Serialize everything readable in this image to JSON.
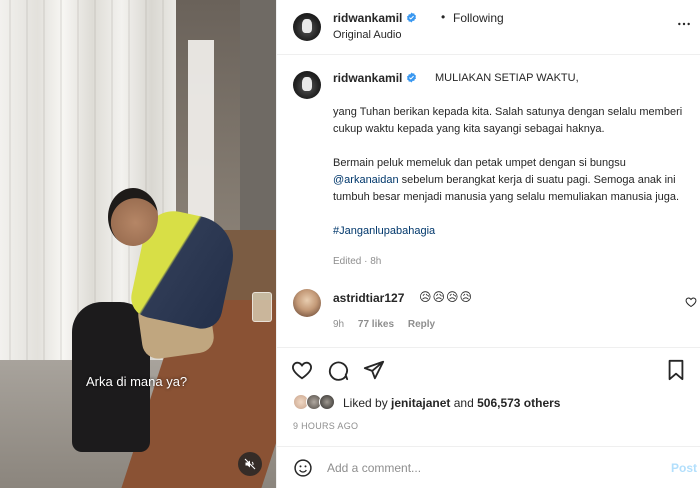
{
  "media": {
    "caption_overlay": "Arka di mana ya?",
    "mute_icon": "speaker-muted-icon"
  },
  "header": {
    "username": "ridwankamil",
    "separator": "•",
    "follow_status": "Following",
    "audio_label": "Original Audio",
    "more_icon": "more-horizontal-icon"
  },
  "caption": {
    "username": "ridwankamil",
    "title": "MULIAKAN SETIAP WAKTU,",
    "paragraph1": "yang Tuhan berikan kepada kita. Salah satunya dengan selalu memberi cukup waktu kepada yang kita sayangi sebagai hak­nya.",
    "paragraph2_before": "Bermain peluk memeluk dan petak umpet dengan si bungsu ",
    "paragraph2_mention": "@arkanaidan",
    "paragraph2_after": " sebelum berangkat kerja di suatu pagi. Semoga anak ini tumbuh besar menjadi manusia yang selalu memuliakan manusia juga.",
    "hashtag": "#Janganlupabahagia",
    "edited": "Edited · 8h"
  },
  "comment": {
    "username": "astridtiar127",
    "text": "😥😥😥😥",
    "age": "9h",
    "likes": "77 likes",
    "reply": "Reply"
  },
  "actions": {
    "like_icon": "heart-icon",
    "comment_icon": "comment-bubble-icon",
    "share_icon": "paper-plane-icon",
    "save_icon": "bookmark-icon"
  },
  "likes": {
    "prefix": "Liked by ",
    "user": "jenitajanet",
    "middle": " and ",
    "count": "506,573 others"
  },
  "timestamp": "9 HOURS AGO",
  "add_comment": {
    "placeholder": "Add a comment...",
    "post_label": "Post"
  },
  "colors": {
    "verified_blue": "#3897f0",
    "post_disabled": "#b2dffc",
    "muted_text": "#8e8e8e"
  }
}
